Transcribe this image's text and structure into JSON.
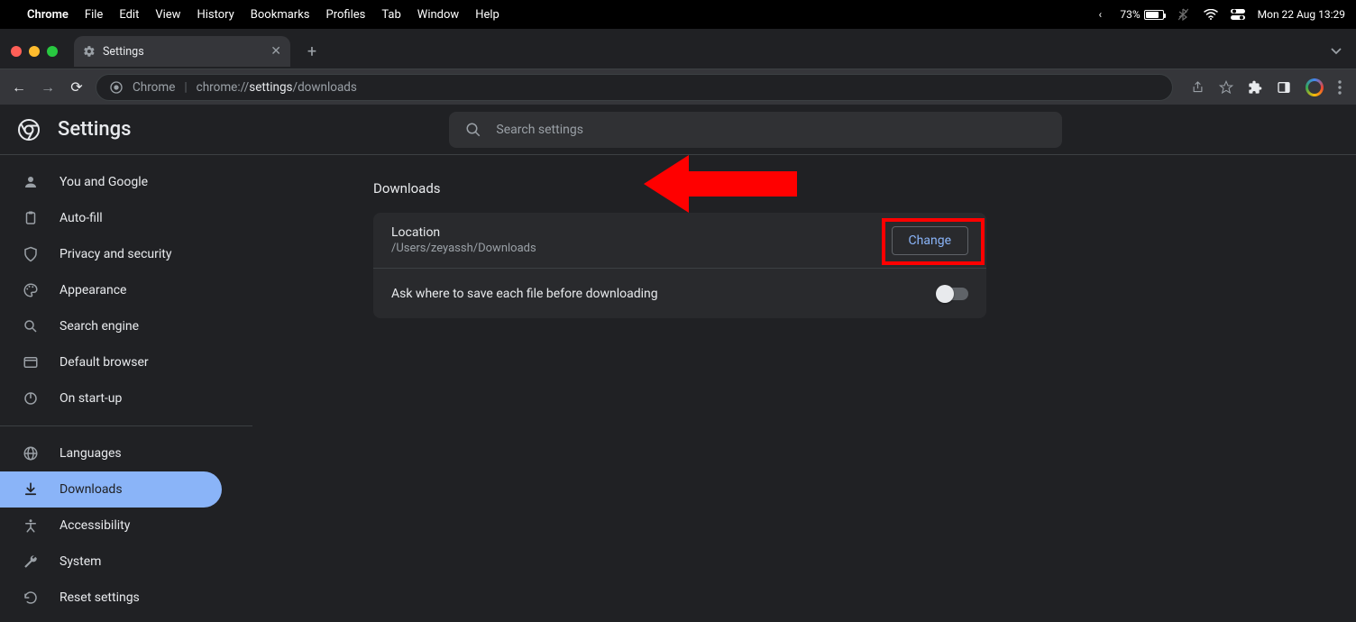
{
  "menubar": {
    "app": "Chrome",
    "items": [
      "File",
      "Edit",
      "View",
      "History",
      "Bookmarks",
      "Profiles",
      "Tab",
      "Window",
      "Help"
    ],
    "battery_pct": "73%",
    "datetime": "Mon 22 Aug  13:29"
  },
  "tab": {
    "title": "Settings"
  },
  "omnibox": {
    "site": "Chrome",
    "scheme": "chrome://",
    "path_hl": "settings",
    "path_rest": "/downloads"
  },
  "header": {
    "title": "Settings",
    "search_placeholder": "Search settings"
  },
  "sidebar": {
    "items": [
      {
        "label": "You and Google"
      },
      {
        "label": "Auto-fill"
      },
      {
        "label": "Privacy and security"
      },
      {
        "label": "Appearance"
      },
      {
        "label": "Search engine"
      },
      {
        "label": "Default browser"
      },
      {
        "label": "On start-up"
      }
    ],
    "items2": [
      {
        "label": "Languages"
      },
      {
        "label": "Downloads"
      },
      {
        "label": "Accessibility"
      },
      {
        "label": "System"
      },
      {
        "label": "Reset settings"
      }
    ]
  },
  "main": {
    "section": "Downloads",
    "location_label": "Location",
    "location_path": "/Users/zeyassh/Downloads",
    "change_label": "Change",
    "ask_label": "Ask where to save each file before downloading"
  }
}
